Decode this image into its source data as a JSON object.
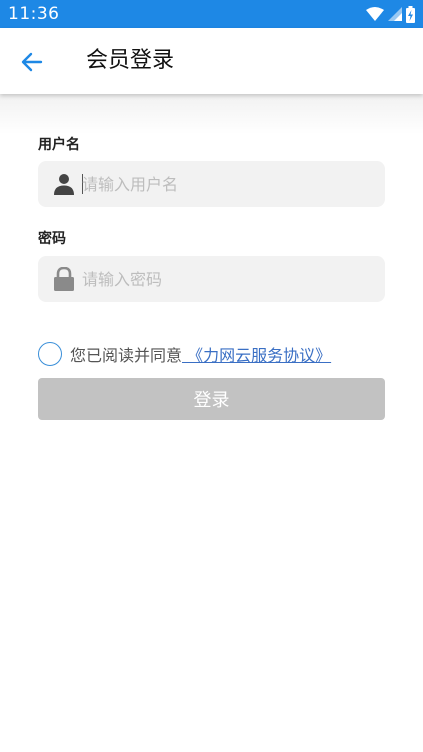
{
  "status_bar": {
    "time": "11:36",
    "icons": [
      "wifi-icon",
      "signal-icon",
      "battery-charging-icon"
    ]
  },
  "app_bar": {
    "back_icon": "arrow-left-icon",
    "title": "会员登录",
    "accent_color": "#1e88e5"
  },
  "form": {
    "username": {
      "label": "用户名",
      "placeholder": "请输入用户名",
      "value": "",
      "icon": "user-icon"
    },
    "password": {
      "label": "密码",
      "placeholder": "请输入密码",
      "value": "",
      "icon": "lock-icon"
    }
  },
  "agreement": {
    "checked": false,
    "text": "您已阅读并同意",
    "link_text": " 《力网云服务协议》"
  },
  "login_button": {
    "label": "登录",
    "color": "#c2c2c2"
  }
}
